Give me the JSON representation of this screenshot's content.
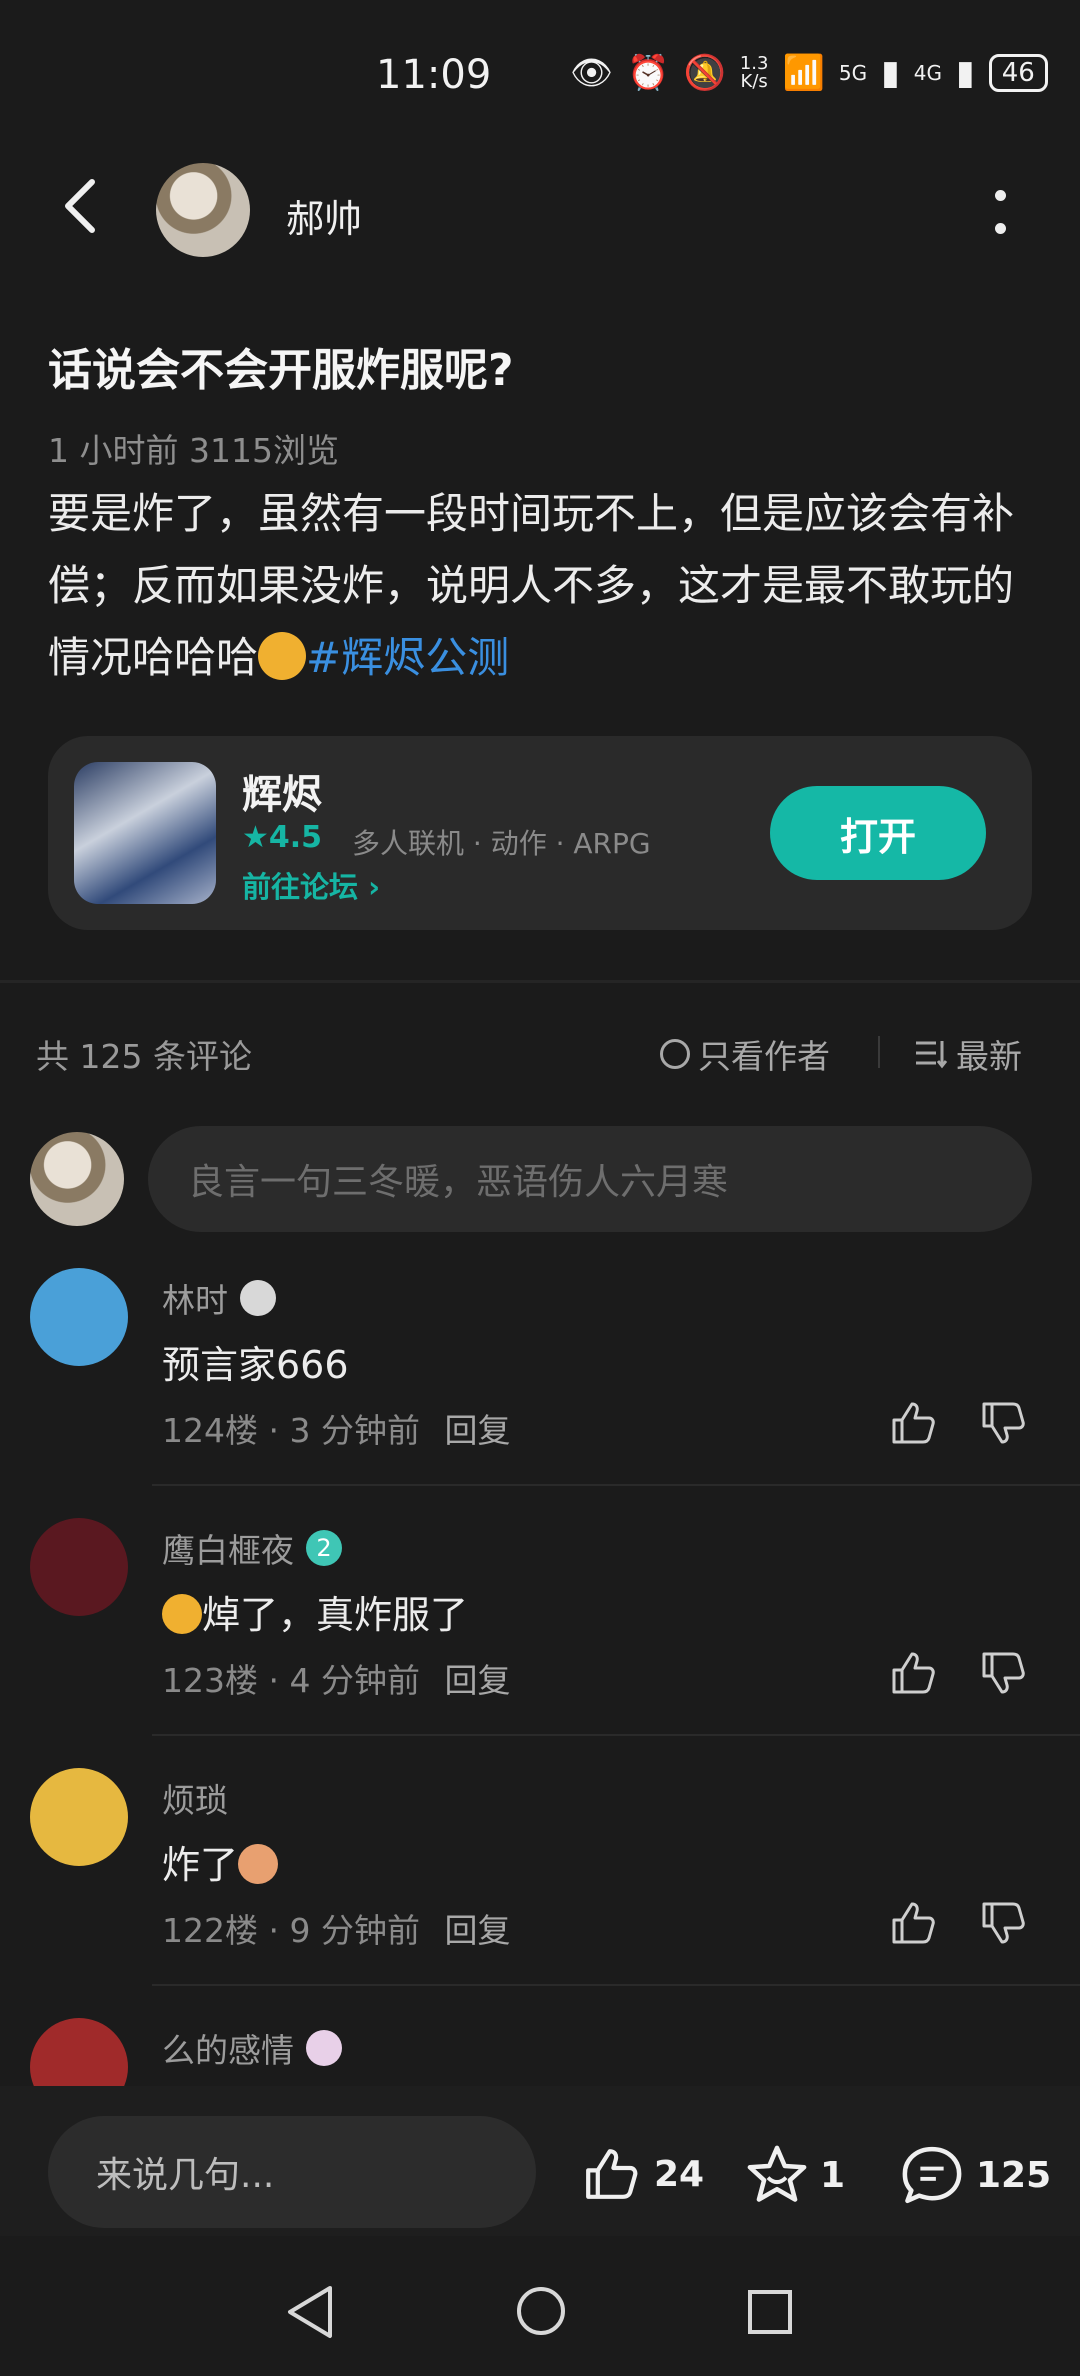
{
  "status_bar": {
    "time": "11:09",
    "speed_value": "1.3",
    "speed_unit": "K/s",
    "net_5g": "5G",
    "net_4g": "4G",
    "battery": "46"
  },
  "header": {
    "author_name": "郝帅"
  },
  "post": {
    "title": "话说会不会开服炸服呢?",
    "meta": "1 小时前   3115浏览",
    "body": "要是炸了，虽然有一段时间玩不上，但是应该会有补偿；反而如果没炸，说明人不多，这才是最不敢玩的情况哈哈哈",
    "hashtag": "#辉烬公测"
  },
  "game_card": {
    "name": "辉烬",
    "rating": "4.5",
    "tags": "多人联机 · 动作 · ARPG",
    "forum_link": "前往论坛",
    "open_button": "打开"
  },
  "comments_header": {
    "count_text": "共 125 条评论",
    "author_only": "只看作者",
    "sort": "最新"
  },
  "comment_input": {
    "placeholder": "良言一句三冬暖，恶语伤人六月寒"
  },
  "comments": [
    {
      "name": "林时",
      "text": "预言家666",
      "floor": "124楼",
      "time": "3 分钟前",
      "reply": "回复",
      "avatar_color": "#4aa0d8",
      "badge_color": "#d8d8d8"
    },
    {
      "name": "鹰白榧夜",
      "text": "焯了，真炸服了",
      "floor": "123楼",
      "time": "4 分钟前",
      "reply": "回复",
      "avatar_color": "#5a1820",
      "badge_color": "#3fc6b5",
      "badge_text": "2"
    },
    {
      "name": "烦琐",
      "text": "炸了",
      "floor": "122楼",
      "time": "9 分钟前",
      "reply": "回复",
      "avatar_color": "#e6b840",
      "badge_color": "#d8c5e8"
    },
    {
      "name": "么的感情",
      "avatar_color": "#a02a2a",
      "badge_color": "#e8d0e8"
    }
  ],
  "bottom_bar": {
    "input_placeholder": "来说几句...",
    "likes": "24",
    "favorites": "1",
    "comments": "125"
  },
  "colors": {
    "accent": "#15b8a6",
    "hashtag": "#3a8fe0",
    "background": "#1b1b1b"
  },
  "icons": [
    "back-icon",
    "more-icon",
    "star-icon",
    "chevron-right-icon",
    "circle-icon",
    "sort-icon",
    "thumb-up-icon",
    "thumb-down-icon",
    "favorite-star-icon",
    "comment-icon",
    "nav-back-icon",
    "nav-home-icon",
    "nav-recents-icon"
  ]
}
